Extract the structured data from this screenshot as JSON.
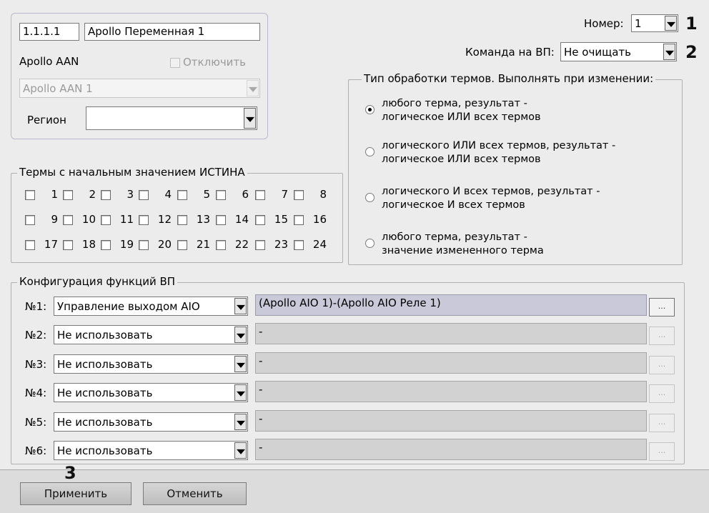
{
  "object": {
    "id": "1.1.1.1",
    "name": "Apollo Переменная 1",
    "parent_label": "Apollo AAN",
    "disable_label": "Отключить",
    "parent_select": "Apollo AAN 1",
    "region_label": "Регион",
    "region_value": ""
  },
  "number": {
    "label": "Номер:",
    "value": "1"
  },
  "vp_command": {
    "label": "Команда на ВП:",
    "value": "Не очищать"
  },
  "terms": {
    "title": "Термы с начальным значением ИСТИНА",
    "items": [
      "1",
      "2",
      "3",
      "4",
      "5",
      "6",
      "7",
      "8",
      "9",
      "10",
      "11",
      "12",
      "13",
      "14",
      "15",
      "16",
      "17",
      "18",
      "19",
      "20",
      "21",
      "22",
      "23",
      "24"
    ]
  },
  "processing": {
    "title": "Тип обработки термов. Выполнять при изменении:",
    "options": [
      {
        "line1": "любого терма, результат -",
        "line2": "логическое ИЛИ всех термов",
        "checked": true
      },
      {
        "line1": "логического ИЛИ всех термов, результат -",
        "line2": "логическое ИЛИ всех термов",
        "checked": false
      },
      {
        "line1": "логического И всех термов, результат -",
        "line2": "логическое И всех термов",
        "checked": false
      },
      {
        "line1": "любого терма, результат -",
        "line2": "значение измененного терма",
        "checked": false
      }
    ]
  },
  "vp_config": {
    "title": "Конфигурация функций ВП",
    "rows": [
      {
        "label": "№1:",
        "func": "Управление выходом AIO",
        "object": "(Apollo AIO 1)-(Apollo AIO Реле 1)",
        "button": "...",
        "active": true
      },
      {
        "label": "№2:",
        "func": "Не использовать",
        "object": "-",
        "button": "...",
        "active": false
      },
      {
        "label": "№3:",
        "func": "Не использовать",
        "object": "-",
        "button": "...",
        "active": false
      },
      {
        "label": "№4:",
        "func": "Не использовать",
        "object": "-",
        "button": "...",
        "active": false
      },
      {
        "label": "№5:",
        "func": "Не использовать",
        "object": "-",
        "button": "...",
        "active": false
      },
      {
        "label": "№6:",
        "func": "Не использовать",
        "object": "-",
        "button": "...",
        "active": false
      }
    ]
  },
  "buttons": {
    "apply": "Применить",
    "cancel": "Отменить"
  },
  "markers": {
    "m1": "1",
    "m2": "2",
    "m3": "3"
  }
}
